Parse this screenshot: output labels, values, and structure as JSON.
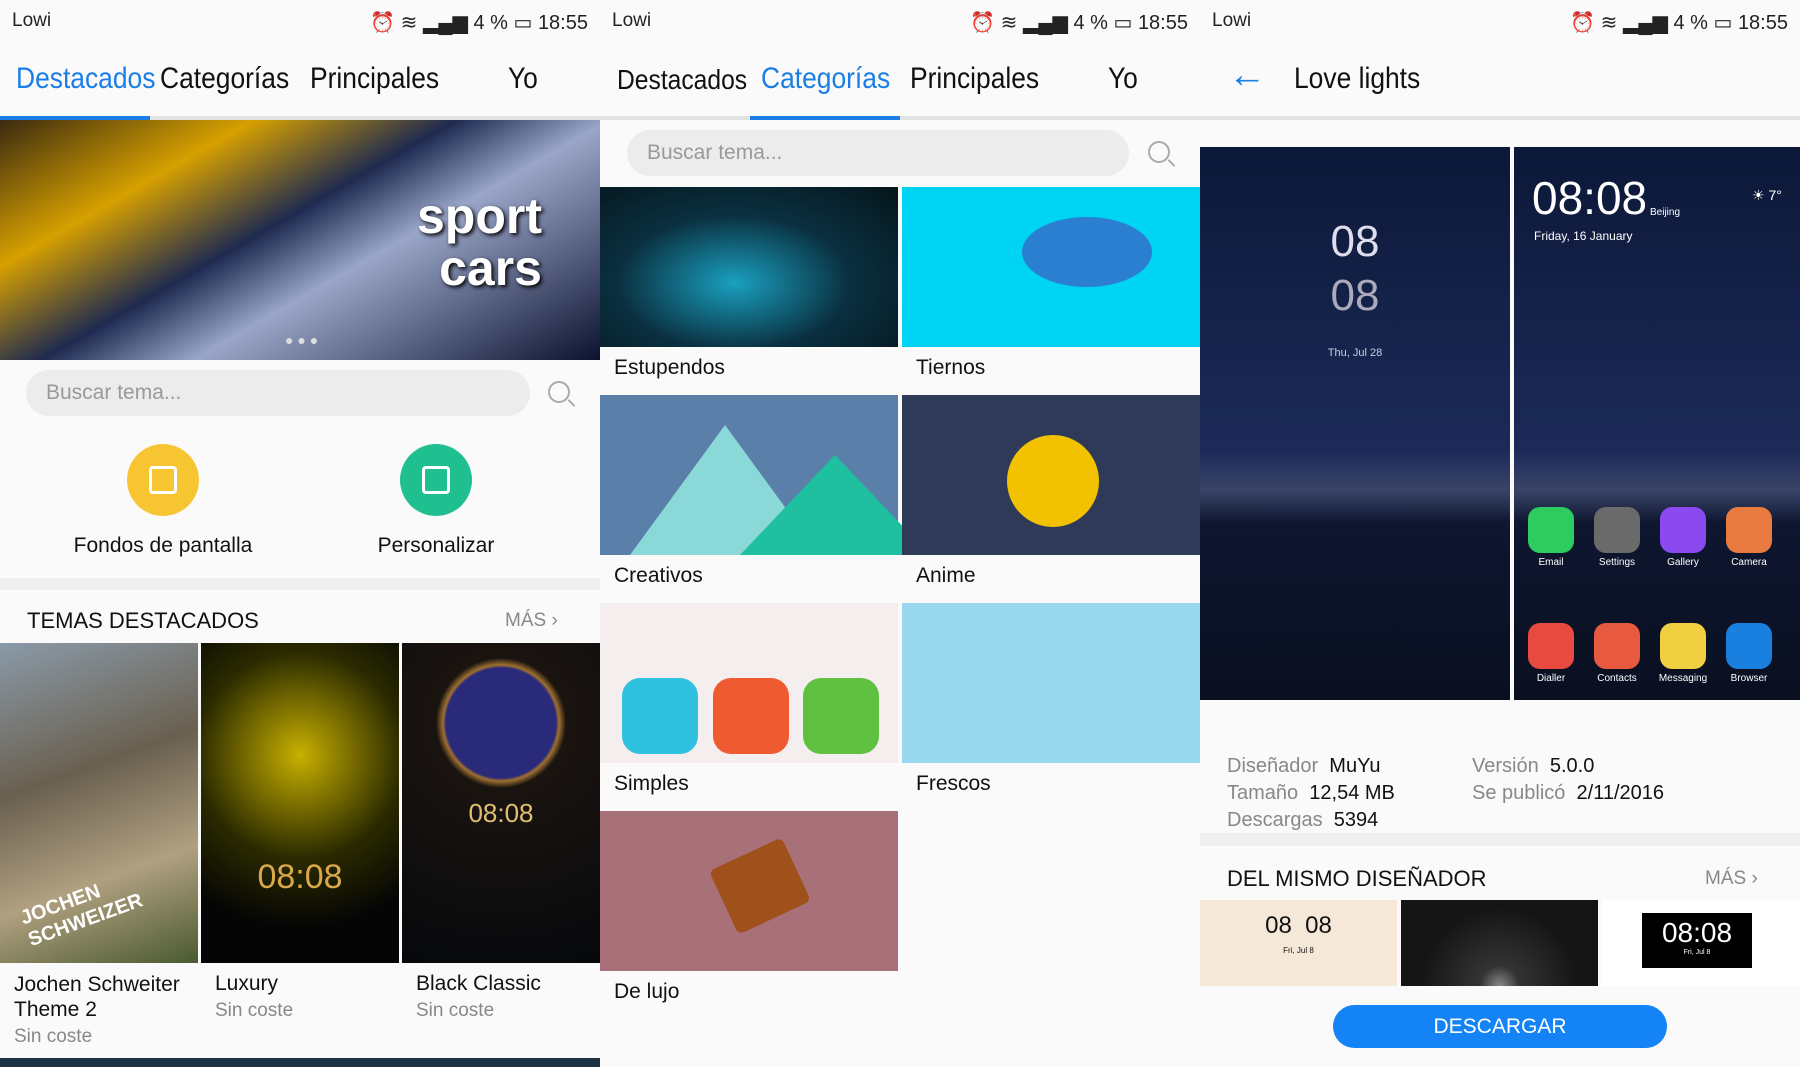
{
  "status": {
    "carrier": "Lowi",
    "battery": "4 %",
    "time": "18:55"
  },
  "tabs": [
    "Destacados",
    "Categorías",
    "Principales",
    "Yo"
  ],
  "p1": {
    "banner_text": [
      "sport",
      "cars"
    ],
    "search_placeholder": "Buscar tema...",
    "shortcuts": [
      {
        "label": "Fondos de pantalla",
        "icon": "wallpaper-icon",
        "color": "#f6c531"
      },
      {
        "label": "Personalizar",
        "icon": "customize-icon",
        "color": "#1fbf8f"
      }
    ],
    "section_title": "TEMAS DESTACADOS",
    "more": "MÁS",
    "themes": [
      {
        "title": "Jochen Schweiter Theme 2",
        "price": "Sin coste",
        "overlay": "JOCHEN SCHWEIZER"
      },
      {
        "title": "Luxury",
        "price": "Sin coste",
        "clock": "08:08"
      },
      {
        "title": "Black Classic",
        "price": "Sin coste",
        "clock": "08:08"
      }
    ]
  },
  "p2": {
    "search_placeholder": "Buscar tema...",
    "categories": [
      "Estupendos",
      "Tiernos",
      "Creativos",
      "Anime",
      "Simples",
      "Frescos",
      "De lujo"
    ]
  },
  "p3": {
    "title": "Love lights",
    "preview": {
      "lock_hour": "08",
      "lock_min": "08",
      "lock_date": "Thu, Jul 28",
      "home_time": "08:08",
      "home_city": "Beijing",
      "home_date": "Friday, 16 January",
      "weather": "7°",
      "apps_row1": [
        "Email",
        "Settings",
        "Gallery",
        "Camera"
      ],
      "apps_row2": [
        "Dialler",
        "Contacts",
        "Messaging",
        "Browser"
      ]
    },
    "info": {
      "designer_label": "Diseñador",
      "designer": "MuYu",
      "size_label": "Tamaño",
      "size": "12,54 MB",
      "downloads_label": "Descargas",
      "downloads": "5394",
      "version_label": "Versión",
      "version": "5.0.0",
      "published_label": "Se publicó",
      "published": "2/11/2016"
    },
    "section_title": "DEL MISMO DISEÑADOR",
    "more": "MÁS",
    "same_designer": [
      {
        "clock": "08  08",
        "date": "Fri, Jul 8"
      },
      {
        "clock": ""
      },
      {
        "clock": "08:08",
        "date": "Fri, Jul 8"
      }
    ],
    "download": "DESCARGAR"
  },
  "colors": {
    "accent": "#1a7ee6",
    "button": "#1483f5"
  }
}
